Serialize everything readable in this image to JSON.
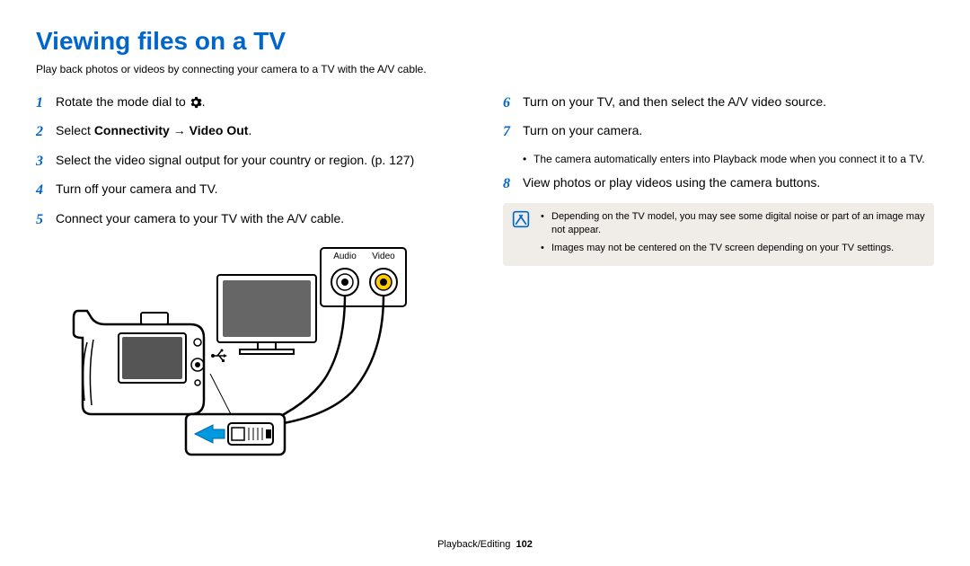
{
  "title": "Viewing files on a TV",
  "subtitle": "Play back photos or videos by connecting your camera to a TV with the A/V cable.",
  "left_steps": [
    {
      "num": "1",
      "text_before": "Rotate the mode dial to ",
      "icon": "gear",
      "text_after": "."
    },
    {
      "num": "2",
      "text_before": "Select ",
      "bold1": "Connectivity",
      "arrow": " → ",
      "bold2": "Video Out",
      "text_after": "."
    },
    {
      "num": "3",
      "text": "Select the video signal output for your country or region. (p. 127)"
    },
    {
      "num": "4",
      "text": "Turn off your camera and TV."
    },
    {
      "num": "5",
      "text": "Connect your camera to your TV with the A/V cable."
    }
  ],
  "diagram_labels": {
    "audio": "Audio",
    "video": "Video"
  },
  "right_steps": [
    {
      "num": "6",
      "text": "Turn on your TV, and then select the A/V video source."
    },
    {
      "num": "7",
      "text": "Turn on your camera.",
      "sub": "The camera automatically enters into Playback mode when you connect it to a TV."
    },
    {
      "num": "8",
      "text": "View photos or play videos using the camera buttons."
    }
  ],
  "notes": [
    "Depending on the TV model, you may see some digital noise or part of an image may not appear.",
    "Images may not be centered on the TV screen depending on your TV settings."
  ],
  "footer": {
    "section": "Playback/Editing",
    "page": "102"
  }
}
